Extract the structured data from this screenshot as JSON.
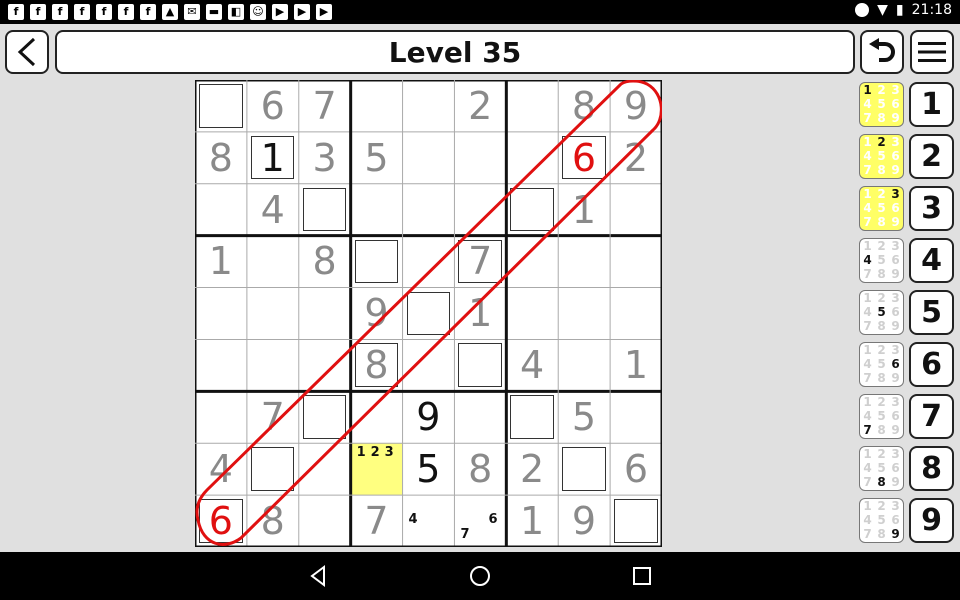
{
  "status_bar": {
    "time": "21:18",
    "notification_icons": [
      "facebook-icon",
      "facebook-icon",
      "facebook-icon",
      "facebook-icon",
      "facebook-icon",
      "facebook-icon",
      "facebook-icon",
      "image-icon",
      "mail-icon",
      "chat-icon",
      "bag-icon",
      "android-icon",
      "youtube-icon",
      "youtube-icon",
      "youtube-icon"
    ],
    "notification_glyphs": [
      "f",
      "f",
      "f",
      "f",
      "f",
      "f",
      "f",
      "▲",
      "✉",
      "▬",
      "◧",
      "☺",
      "▶",
      "▶",
      "▶"
    ]
  },
  "header": {
    "title": "Level 35"
  },
  "board": {
    "cells": [
      [
        "",
        "6",
        "7",
        "",
        "",
        "2",
        "",
        "8",
        "9"
      ],
      [
        "8",
        "1",
        "3",
        "5",
        "",
        "",
        "",
        "6",
        "2"
      ],
      [
        "",
        "4",
        "",
        "",
        "",
        "",
        "",
        "1",
        ""
      ],
      [
        "1",
        "",
        "8",
        "",
        "",
        "7",
        "",
        "",
        ""
      ],
      [
        "",
        "",
        "",
        "9",
        "",
        "1",
        "",
        "",
        ""
      ],
      [
        "",
        "",
        "",
        "8",
        "",
        "",
        "4",
        "",
        "1"
      ],
      [
        "",
        "7",
        "",
        "",
        "9",
        "",
        "",
        "5",
        ""
      ],
      [
        "4",
        "",
        "",
        "",
        "5",
        "8",
        "2",
        "",
        "6"
      ],
      [
        "6",
        "8",
        "",
        "7",
        "",
        "",
        "1",
        "9",
        ""
      ]
    ],
    "kinds": [
      [
        "box",
        "given",
        "given",
        "",
        "",
        "given",
        "",
        "given",
        "given"
      ],
      [
        "given",
        "userbox",
        "given",
        "given",
        "",
        "",
        "",
        "errorbox",
        "given"
      ],
      [
        "",
        "given",
        "box",
        "",
        "",
        "",
        "box",
        "given",
        ""
      ],
      [
        "given",
        "",
        "given",
        "box",
        "",
        "givenbox",
        "",
        "",
        ""
      ],
      [
        "",
        "",
        "",
        "given",
        "box",
        "given",
        "",
        "",
        ""
      ],
      [
        "",
        "",
        "",
        "givenbox",
        "",
        "box",
        "given",
        "",
        "given"
      ],
      [
        "",
        "given",
        "box",
        "",
        "user",
        "",
        "box",
        "given",
        ""
      ],
      [
        "given",
        "box",
        "",
        "selected",
        "user",
        "given",
        "given",
        "box",
        "given"
      ],
      [
        "errorbox",
        "given",
        "",
        "given",
        "notes",
        "notes",
        "given",
        "given",
        "box"
      ]
    ],
    "pencil_marks": {
      "r8c4": {
        "notes": [
          "1",
          "2",
          "3"
        ]
      },
      "r9c5": {
        "notes": [
          "4"
        ]
      },
      "r9c6": {
        "notes": [
          "7",
          "6"
        ]
      }
    },
    "colors": {
      "given": "#8a8a8a",
      "user": "#111111",
      "error": "#e01010",
      "selected_bg": "#ffff80",
      "diagonal_outline": "#e01010"
    }
  },
  "note_buttons": [
    {
      "digit": "1",
      "active": true
    },
    {
      "digit": "2",
      "active": true
    },
    {
      "digit": "3",
      "active": true
    },
    {
      "digit": "4",
      "active": false
    },
    {
      "digit": "5",
      "active": false
    },
    {
      "digit": "6",
      "active": false
    },
    {
      "digit": "7",
      "active": false
    },
    {
      "digit": "8",
      "active": false
    },
    {
      "digit": "9",
      "active": false
    }
  ],
  "number_buttons": [
    "1",
    "2",
    "3",
    "4",
    "5",
    "6",
    "7",
    "8",
    "9"
  ],
  "nav_bar": {
    "buttons": [
      "back-triangle",
      "home-circle",
      "recents-square"
    ]
  }
}
